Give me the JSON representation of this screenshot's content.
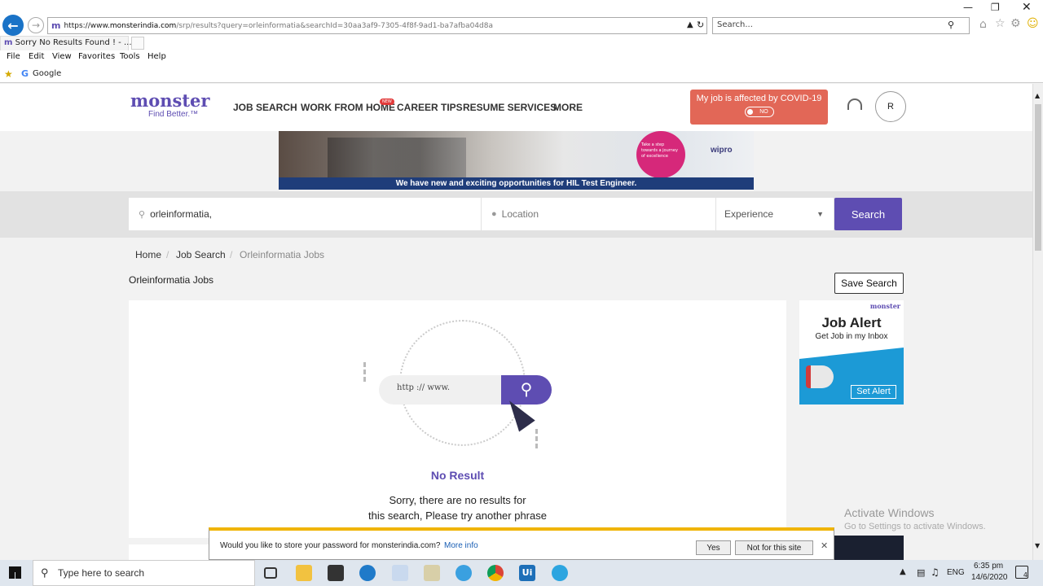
{
  "browser": {
    "url_prefix": "https://www.",
    "url_domain": "monsterindia.com",
    "url_path": "/srp/results?query=orleinformatia&searchId=30aa3af9-7305-4f8f-9ad1-ba7afba04d8a",
    "search_placeholder": "Search...",
    "tab_title": "Sorry No Results Found ! - ...",
    "menu": [
      "File",
      "Edit",
      "View",
      "Favorites",
      "Tools",
      "Help"
    ],
    "favorite": "Google"
  },
  "site": {
    "logo": "monster",
    "tagline": "Find Better.™",
    "nav": [
      "JOB SEARCH",
      "WORK FROM HOME",
      "CAREER TIPS",
      "RESUME SERVICES",
      "MORE"
    ],
    "new_badge": "NEW",
    "covid_text": "My job is affected by COVID-19",
    "covid_toggle": "NO",
    "avatar_letter": "R"
  },
  "banner": {
    "strip_text": "We have new and exciting opportunities for HIL Test Engineer.",
    "badge_text": "Take a step towards a journey of excellence",
    "brand": "wipro"
  },
  "search": {
    "query": "orleinformatia,",
    "location_placeholder": "Location",
    "experience_label": "Experience",
    "button": "Search"
  },
  "breadcrumb": [
    "Home",
    "Job Search",
    "Orleinformatia Jobs"
  ],
  "page_heading": "Orleinformatia Jobs",
  "save_search": "Save Search",
  "result": {
    "illustration_text": "http :// www.",
    "title": "No Result",
    "message_line1": "Sorry, there are no results for",
    "message_line2": "this search, Please try another phrase"
  },
  "job_alert": {
    "brand": "monster",
    "title": "Job Alert",
    "subtitle": "Get Job in my Inbox",
    "button": "Set Alert"
  },
  "password_bar": {
    "prompt": "Would you like to store your password for monsterindia.com?",
    "more_info": "More info",
    "yes": "Yes",
    "no": "Not for this site"
  },
  "watermark": {
    "line1": "Activate Windows",
    "line2": "Go to Settings to activate Windows."
  },
  "taskbar": {
    "search_placeholder": "Type here to search",
    "lang": "ENG",
    "time": "6:35 pm",
    "date": "14/6/2020",
    "notif_count": "4"
  },
  "colors": {
    "brand_purple": "#5e4db2",
    "covid_red": "#e26757",
    "alert_blue": "#1c9ad6"
  }
}
